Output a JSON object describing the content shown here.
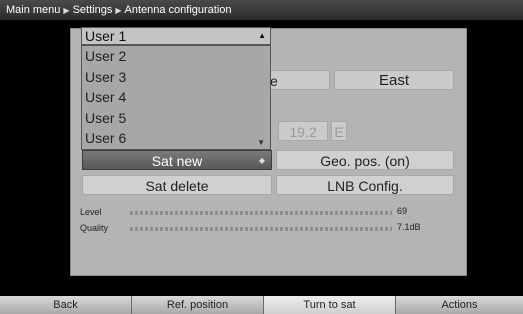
{
  "breadcrumb": {
    "items": [
      "Main menu",
      "Settings",
      "Antenna configuration"
    ]
  },
  "dropdown": {
    "selected": "User 1",
    "options": [
      "User 2",
      "User 3",
      "User 4",
      "User 5",
      "User 6"
    ]
  },
  "grid": {
    "partial_cell": "ve",
    "east": "East",
    "position_value": "19.2",
    "position_dir": "E"
  },
  "buttons": {
    "sat_new": "Sat new",
    "geo_pos": "Geo. pos. (on)",
    "sat_delete": "Sat delete",
    "lnb_config": "LNB Config."
  },
  "meters": {
    "level_label": "Level",
    "level_value": "69",
    "quality_label": "Quality",
    "quality_value": "7.1dB"
  },
  "tabs": [
    "Back",
    "Ref. position",
    "Turn to sat",
    "Actions"
  ]
}
